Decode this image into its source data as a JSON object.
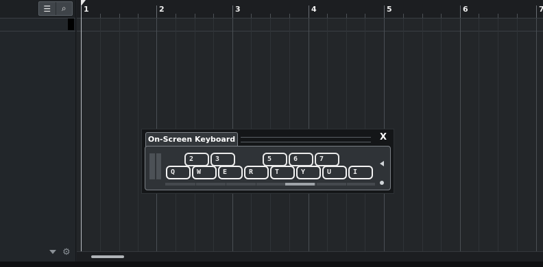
{
  "toolbar": {
    "list_icon": "☰",
    "search_icon": "⌕"
  },
  "ruler": {
    "bars": [
      "1",
      "2",
      "3",
      "4",
      "5",
      "6",
      "7"
    ]
  },
  "left_bottom": {
    "gear_icon": "⚙"
  },
  "keyboard": {
    "title": "On-Screen Keyboard",
    "close_label": "X",
    "black_keys": [
      "2",
      "3",
      "5",
      "6",
      "7"
    ],
    "white_keys": [
      "Q",
      "W",
      "E",
      "R",
      "T",
      "Y",
      "U",
      "I"
    ]
  }
}
